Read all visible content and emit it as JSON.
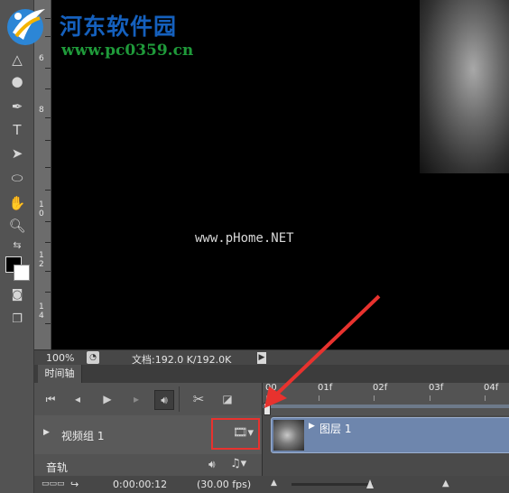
{
  "watermark": {
    "title": "河东软件园",
    "url": "www.pc0359.cn",
    "phome": "www.pHome.NET"
  },
  "ruler": {
    "labels": [
      "6",
      "8",
      "1\n0",
      "1\n2",
      "1\n4"
    ]
  },
  "statusbar": {
    "zoom": "100%",
    "doc_info": "文档:192.0 K/192.0K"
  },
  "timeline": {
    "tab_label": "时间轴",
    "ruler_labels": [
      "00",
      "01f",
      "02f",
      "03f",
      "04f"
    ],
    "video_group_label": "视频组 1",
    "layer_label": "图层 1",
    "audio_label": "音轨",
    "timecode": "0:00:00:12",
    "fps": "(30.00 fps)"
  },
  "icons": {
    "toolbar": [
      "eraser-icon",
      "sharpen-icon",
      "dodge-icon",
      "pen-icon",
      "type-icon",
      "path-select-icon",
      "ellipse-icon",
      "hand-icon",
      "zoom-icon",
      "swap-colors-icon",
      "quick-mask-icon",
      "screen-mode-icon"
    ],
    "controls": [
      "go-to-first-frame-icon",
      "previous-frame-icon",
      "play-icon",
      "next-frame-icon",
      "audio-icon",
      "split-scissors-icon",
      "transition-icon"
    ]
  },
  "colors": {
    "annotation_red": "#e8322e",
    "clip_blue": "#6e86ad",
    "watermark_blue": "#1560bd",
    "watermark_green": "#1f9a3a"
  }
}
